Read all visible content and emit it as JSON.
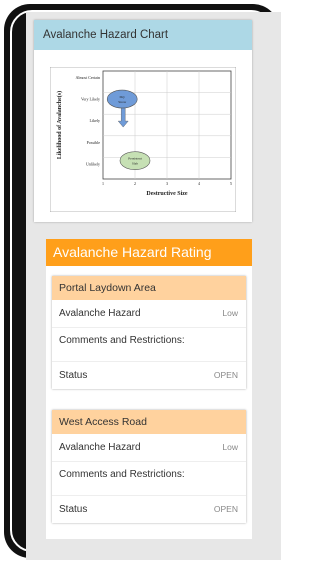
{
  "hazard_chart": {
    "title": "Avalanche Hazard Chart",
    "y_axis_label": "Likelihood of Avalanche(s)",
    "x_axis_label": "Destructive Size",
    "likelihood_levels": [
      "Almost Certain",
      "Very Likely",
      "Likely",
      "Possible",
      "Unlikely"
    ],
    "size_ticks": [
      "1",
      "2",
      "3",
      "4",
      "5"
    ],
    "markers": [
      {
        "label": "Dry\nSnow",
        "size": 1.6,
        "likelihood": 3.7,
        "color": "#6f9bd8"
      },
      {
        "label": "Persistent\nSlab",
        "size": 2.0,
        "likelihood": 0.85,
        "color": "#c6e0b4"
      }
    ]
  },
  "rating": {
    "title": "Avalanche Hazard Rating",
    "areas": [
      {
        "name": "Portal Laydown Area",
        "hazard_label": "Avalanche Hazard",
        "hazard_value": "Low",
        "comments_label": "Comments and Restrictions:",
        "status_label": "Status",
        "status_value": "OPEN"
      },
      {
        "name": "West Access Road",
        "hazard_label": "Avalanche Hazard",
        "hazard_value": "Low",
        "comments_label": "Comments and Restrictions:",
        "status_label": "Status",
        "status_value": "OPEN"
      }
    ]
  }
}
